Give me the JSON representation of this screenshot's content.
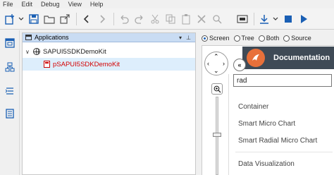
{
  "menu": [
    "File",
    "Edit",
    "Debug",
    "View",
    "Help"
  ],
  "applications": {
    "title": "Applications",
    "items": [
      {
        "label": "SAPUI5SDKDemoKit"
      },
      {
        "label": "pSAPUI5SDKDemoKit"
      }
    ]
  },
  "view_modes": {
    "options": [
      "Screen",
      "Tree",
      "Both",
      "Source"
    ],
    "selected": "Screen"
  },
  "documentation": {
    "title": "Documentation",
    "search_value": "rad",
    "results": [
      "Container",
      "Smart Micro Chart",
      "Smart Radial Micro Chart",
      "Data Visualization"
    ]
  },
  "colors": {
    "header_bg": "#3f4a56",
    "logo": "#e8703a",
    "panel_header": "#c9dcf3",
    "selected_row": "#ddeefc",
    "error_text": "#d40000"
  }
}
